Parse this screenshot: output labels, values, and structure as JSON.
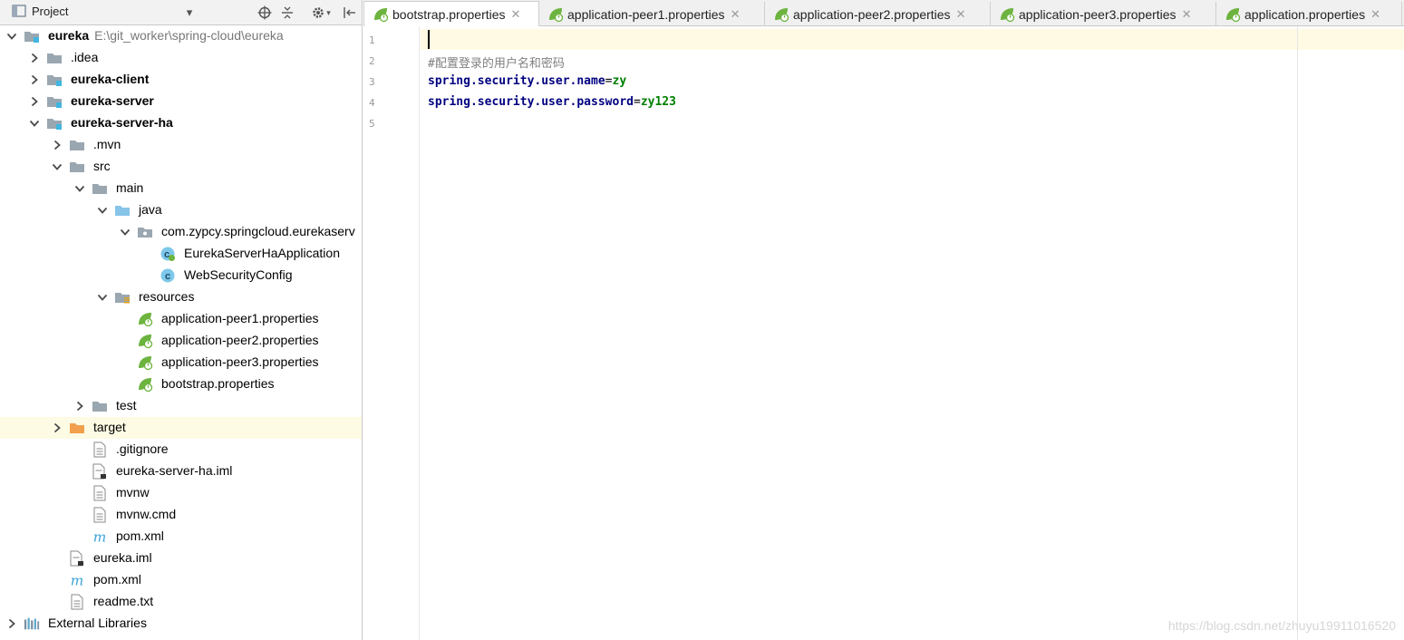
{
  "project_panel": {
    "title": "Project",
    "tree": [
      {
        "label": "eureka",
        "path": "E:\\git_worker\\spring-cloud\\eureka",
        "bold": true,
        "depth": 0,
        "arrow": "down",
        "icon": "module-folder-icon"
      },
      {
        "label": ".idea",
        "depth": 1,
        "arrow": "right",
        "icon": "folder-icon"
      },
      {
        "label": "eureka-client",
        "bold": true,
        "depth": 1,
        "arrow": "right",
        "icon": "module-folder-icon"
      },
      {
        "label": "eureka-server",
        "bold": true,
        "depth": 1,
        "arrow": "right",
        "icon": "module-folder-icon"
      },
      {
        "label": "eureka-server-ha",
        "bold": true,
        "depth": 1,
        "arrow": "down",
        "icon": "module-folder-icon"
      },
      {
        "label": ".mvn",
        "depth": 2,
        "arrow": "right",
        "icon": "folder-icon"
      },
      {
        "label": "src",
        "depth": 2,
        "arrow": "down",
        "icon": "folder-icon"
      },
      {
        "label": "main",
        "depth": 3,
        "arrow": "down",
        "icon": "folder-icon"
      },
      {
        "label": "java",
        "depth": 4,
        "arrow": "down",
        "icon": "source-folder-icon"
      },
      {
        "label": "com.zypcy.springcloud.eurekaserv",
        "depth": 5,
        "arrow": "down",
        "icon": "package-icon"
      },
      {
        "label": "EurekaServerHaApplication",
        "depth": 6,
        "arrow": "",
        "icon": "spring-boot-class-icon"
      },
      {
        "label": "WebSecurityConfig",
        "depth": 6,
        "arrow": "",
        "icon": "class-icon"
      },
      {
        "label": "resources",
        "depth": 4,
        "arrow": "down",
        "icon": "resources-folder-icon"
      },
      {
        "label": "application-peer1.properties",
        "depth": 5,
        "arrow": "",
        "icon": "spring-properties-icon"
      },
      {
        "label": "application-peer2.properties",
        "depth": 5,
        "arrow": "",
        "icon": "spring-properties-icon"
      },
      {
        "label": "application-peer3.properties",
        "depth": 5,
        "arrow": "",
        "icon": "spring-properties-icon"
      },
      {
        "label": "bootstrap.properties",
        "depth": 5,
        "arrow": "",
        "icon": "spring-properties-icon"
      },
      {
        "label": "test",
        "depth": 3,
        "arrow": "right",
        "icon": "folder-icon"
      },
      {
        "label": "target",
        "depth": 2,
        "arrow": "right",
        "icon": "excluded-folder-icon",
        "selected": true
      },
      {
        "label": ".gitignore",
        "depth": 3,
        "arrow": "",
        "icon": "text-file-icon"
      },
      {
        "label": "eureka-server-ha.iml",
        "depth": 3,
        "arrow": "",
        "icon": "iml-file-icon"
      },
      {
        "label": "mvnw",
        "depth": 3,
        "arrow": "",
        "icon": "text-file-icon"
      },
      {
        "label": "mvnw.cmd",
        "depth": 3,
        "arrow": "",
        "icon": "text-file-icon"
      },
      {
        "label": "pom.xml",
        "depth": 3,
        "arrow": "",
        "icon": "maven-icon"
      },
      {
        "label": "eureka.iml",
        "depth": 2,
        "arrow": "",
        "icon": "iml-file-icon"
      },
      {
        "label": "pom.xml",
        "depth": 2,
        "arrow": "",
        "icon": "maven-icon"
      },
      {
        "label": "readme.txt",
        "depth": 2,
        "arrow": "",
        "icon": "text-file-icon"
      },
      {
        "label": "External Libraries",
        "depth": 0,
        "arrow": "right",
        "icon": "libraries-icon"
      }
    ]
  },
  "editor": {
    "tabs": [
      {
        "label": "bootstrap.properties",
        "active": true
      },
      {
        "label": "application-peer1.properties"
      },
      {
        "label": "application-peer2.properties"
      },
      {
        "label": "application-peer3.properties"
      },
      {
        "label": "application.properties"
      }
    ],
    "line_numbers": [
      "1",
      "2",
      "3",
      "4",
      "5"
    ],
    "lines": [
      {
        "parts": []
      },
      {
        "parts": [
          {
            "t": "#配置登录的用户名和密码",
            "cls": "c"
          }
        ]
      },
      {
        "parts": [
          {
            "t": "spring.security.user.name",
            "cls": "k"
          },
          {
            "t": "=",
            "cls": ""
          },
          {
            "t": "zy",
            "cls": "v"
          }
        ]
      },
      {
        "parts": [
          {
            "t": "spring.security.user.password",
            "cls": "k"
          },
          {
            "t": "=",
            "cls": ""
          },
          {
            "t": "zy123",
            "cls": "v"
          }
        ]
      },
      {
        "parts": []
      }
    ]
  },
  "watermark": "https://blog.csdn.net/zhuyu19911016520",
  "colors": {
    "selected_row": "#fdfbe4",
    "current_line": "#fffae3",
    "key": "#000080",
    "value": "#008000",
    "comment": "#808080"
  }
}
